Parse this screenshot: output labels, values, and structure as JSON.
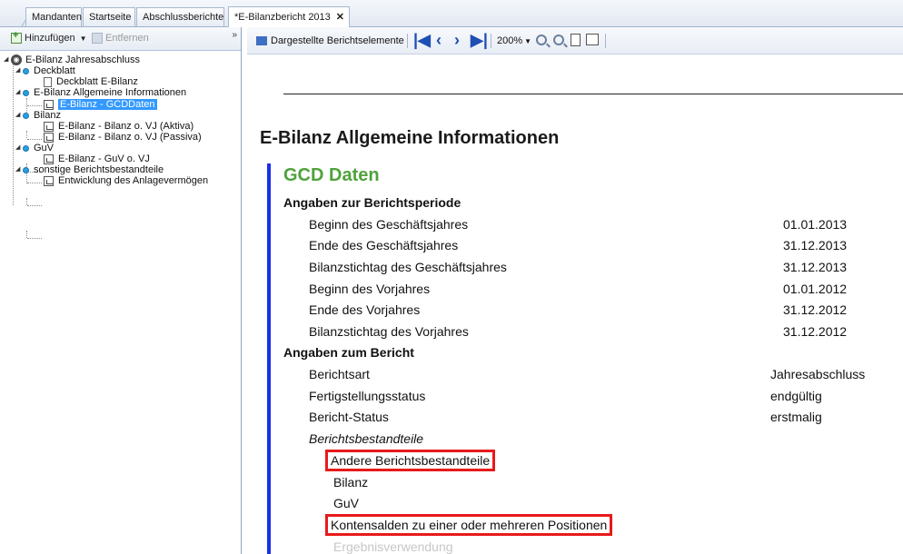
{
  "tabs": [
    {
      "label": "Mandanten"
    },
    {
      "label": "Startseite"
    },
    {
      "label": "Abschlussberichte"
    },
    {
      "label": "*E-Bilanzbericht 2013",
      "close": "✕"
    }
  ],
  "left_toolbar": {
    "add_label": "Hinzufügen",
    "remove_label": "Entfernen",
    "collapse_glyph": "»"
  },
  "tree": {
    "root": "E-Bilanz Jahresabschluss",
    "nodes": [
      {
        "label": "Deckblatt"
      },
      {
        "label": "Deckblatt E-Bilanz"
      },
      {
        "label": "E-Bilanz Allgemeine Informationen"
      },
      {
        "label": "E-Bilanz - GCDDaten"
      },
      {
        "label": "Bilanz"
      },
      {
        "label": "E-Bilanz - Bilanz o. VJ (Aktiva)"
      },
      {
        "label": "E-Bilanz - Bilanz o. VJ (Passiva)"
      },
      {
        "label": "GuV"
      },
      {
        "label": "E-Bilanz - GuV o. VJ"
      },
      {
        "label": "sonstige Berichtsbestandteile"
      },
      {
        "label": "Entwicklung des Anlagevermögen"
      }
    ]
  },
  "right_toolbar": {
    "elements_label": "Dargestellte Berichtselemente",
    "zoom": "200%"
  },
  "report": {
    "title": "E-Bilanz Allgemeine Informationen",
    "subtitle": "GCD Daten",
    "section1": "Angaben zur Berichtsperiode",
    "section2": "Angaben zum Bericht",
    "rows": [
      {
        "label": "Beginn des Geschäftsjahres",
        "value": "01.01.2013"
      },
      {
        "label": "Ende des Geschäftsjahres",
        "value": "31.12.2013"
      },
      {
        "label": "Bilanzstichtag des Geschäftsjahres",
        "value": "31.12.2013"
      },
      {
        "label": "Beginn des Vorjahres",
        "value": "01.01.2012"
      },
      {
        "label": "Ende des Vorjahres",
        "value": "31.12.2012"
      },
      {
        "label": "Bilanzstichtag des Vorjahres",
        "value": "31.12.2012"
      },
      {
        "label": "Berichtsart",
        "value": "Jahresabschluss"
      },
      {
        "label": "Fertigstellungsstatus",
        "value": "endgültig"
      },
      {
        "label": "Bericht-Status",
        "value": "erstmalig"
      }
    ],
    "bestandteile_label": "Berichtsbestandteile",
    "bestandteile": [
      {
        "label": "Andere Berichtsbestandteile"
      },
      {
        "label": "Bilanz"
      },
      {
        "label": "GuV"
      },
      {
        "label": "Kontensalden zu einer oder mehreren Positionen"
      },
      {
        "label": "Ergebnisverwendung"
      }
    ]
  }
}
